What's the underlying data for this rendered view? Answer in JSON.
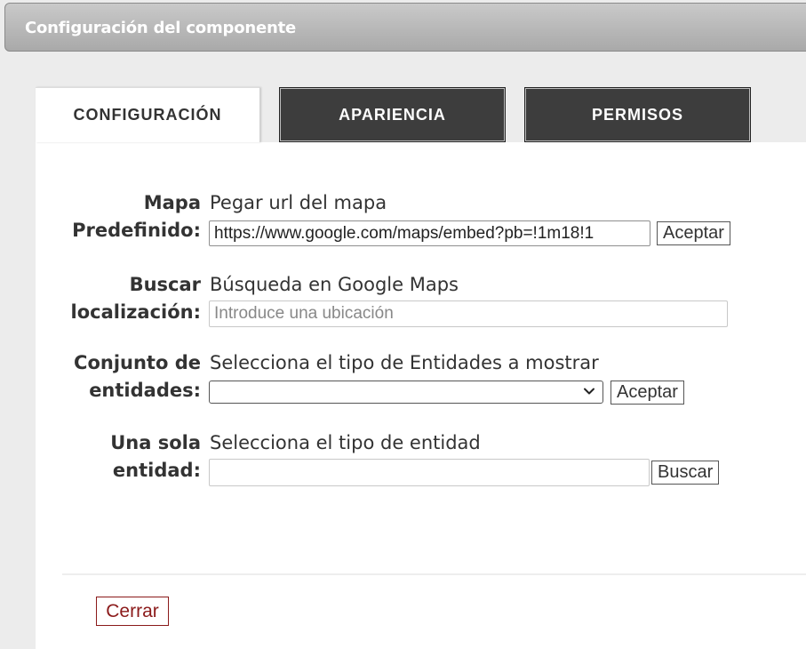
{
  "window": {
    "title": "Configuración del componente"
  },
  "tabs": [
    {
      "label": "CONFIGURACIÓN",
      "active": true
    },
    {
      "label": "APARIENCIA",
      "active": false
    },
    {
      "label": "PERMISOS",
      "active": false
    }
  ],
  "form": {
    "map": {
      "label_line1": "Mapa",
      "label_line2": "Predefinido:",
      "hint": "Pegar url del mapa",
      "value": "https://www.google.com/maps/embed?pb=!1m18!1",
      "button": "Aceptar"
    },
    "search": {
      "label_line1": "Buscar",
      "label_line2": "localización:",
      "hint": "Búsqueda en Google Maps",
      "placeholder": "Introduce una ubicación"
    },
    "entity_set": {
      "label_line1": "Conjunto de",
      "label_line2": "entidades:",
      "hint": "Selecciona el tipo de Entidades a mostrar",
      "selected": "",
      "button": "Aceptar"
    },
    "single_entity": {
      "label_line1": "Una sola",
      "label_line2": "entidad:",
      "hint": "Selecciona el tipo de entidad",
      "value": "",
      "button": "Buscar"
    }
  },
  "footer": {
    "close_label": "Cerrar"
  },
  "colors": {
    "tab_dark": "#3d3d3d",
    "close_accent": "#8b1a1a"
  },
  "icons": {
    "select_arrow": "chevron-down-icon"
  }
}
